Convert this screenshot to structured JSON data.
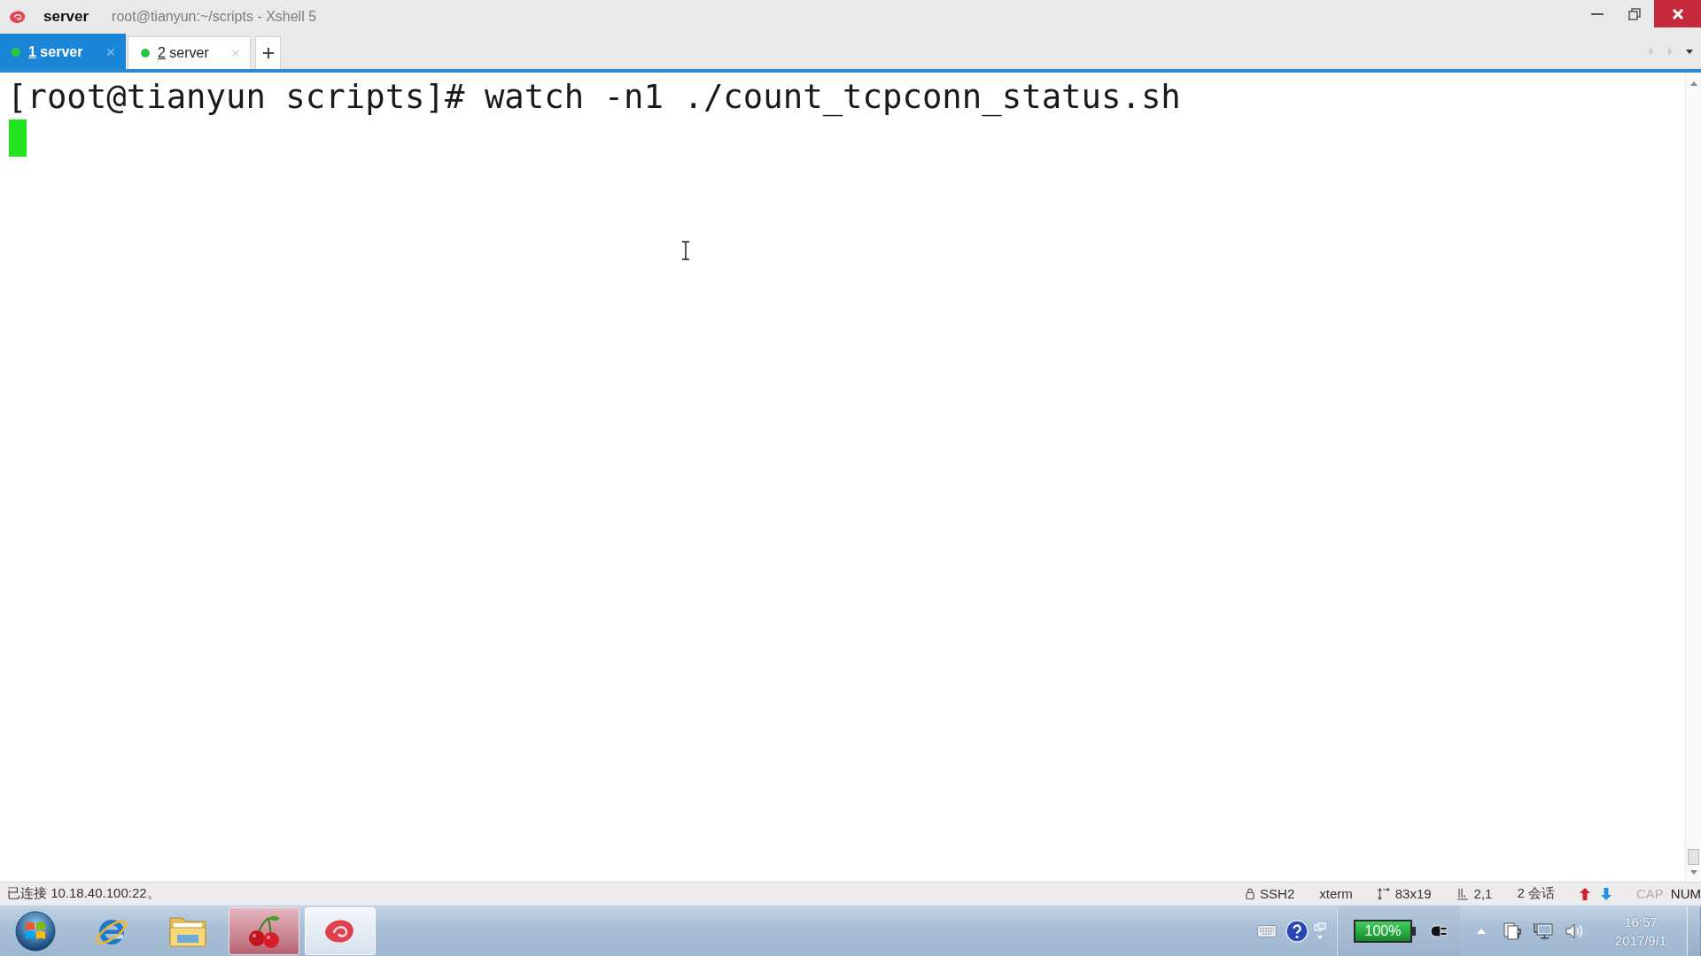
{
  "window": {
    "title": "server",
    "subtitle": "root@tianyun:~/scripts - Xshell 5"
  },
  "tabs": [
    {
      "hotkey": "1",
      "label": "server",
      "selected": true,
      "connected": true
    },
    {
      "hotkey": "2",
      "label": "server",
      "selected": false,
      "connected": true
    }
  ],
  "tab_nav": [
    {
      "kind": "left",
      "disabled": true
    },
    {
      "kind": "right",
      "disabled": true
    },
    {
      "kind": "menu",
      "disabled": false
    }
  ],
  "terminal": {
    "lines": [
      "[root@tianyun scripts]# watch -n1 ./count_tcpconn_status.sh"
    ]
  },
  "status_bar": {
    "message": "已连接 10.18.40.100:22。",
    "items": [
      {
        "kind": "lock",
        "text": "SSH2"
      },
      {
        "kind": "plain",
        "text": "xterm"
      },
      {
        "kind": "size",
        "text": "83x19"
      },
      {
        "kind": "position",
        "text": "2,1"
      },
      {
        "kind": "plain",
        "text": "2 会话"
      }
    ],
    "indicators": [
      {
        "text": "CAP",
        "on": false
      },
      {
        "text": "NUM",
        "on": true
      }
    ]
  },
  "taskbar": {
    "apps": [
      {
        "kind": "browser",
        "running": false,
        "selected": false
      },
      {
        "kind": "folder",
        "running": false,
        "selected": false
      },
      {
        "kind": "cherry",
        "running": true,
        "selected": false
      },
      {
        "kind": "shell",
        "running": true,
        "selected": true
      }
    ],
    "battery": {
      "label": "100%"
    },
    "clock": {
      "time": "16:57",
      "date": "2017/9/1"
    }
  }
}
